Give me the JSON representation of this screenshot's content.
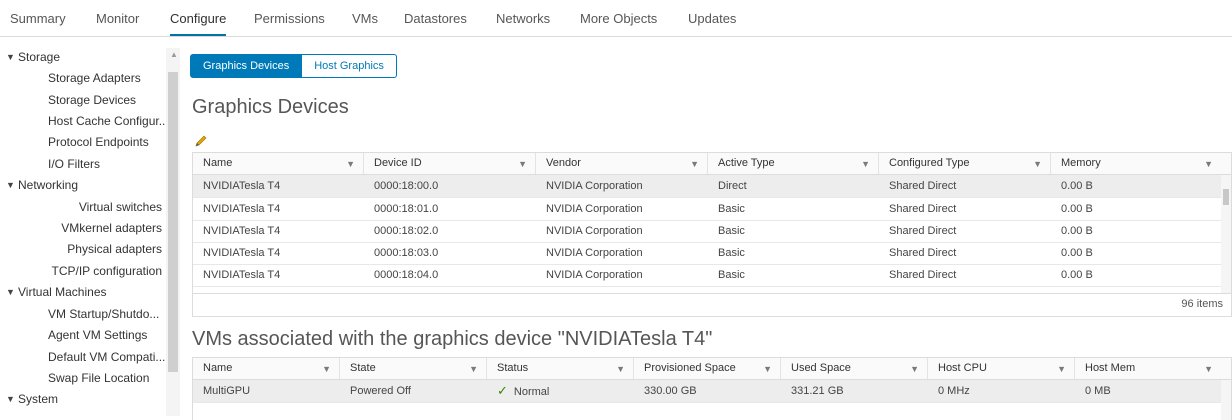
{
  "tabs": [
    "Summary",
    "Monitor",
    "Configure",
    "Permissions",
    "VMs",
    "Datastores",
    "Networks",
    "More Objects",
    "Updates"
  ],
  "active_tab": "Configure",
  "sidebar": {
    "storage": {
      "label": "Storage",
      "items": [
        "Storage Adapters",
        "Storage Devices",
        "Host Cache Configur...",
        "Protocol Endpoints",
        "I/O Filters"
      ]
    },
    "networking": {
      "label": "Networking",
      "items": [
        "Virtual switches",
        "VMkernel adapters",
        "Physical adapters",
        "TCP/IP configuration"
      ]
    },
    "vms": {
      "label": "Virtual Machines",
      "items": [
        "VM Startup/Shutdo...",
        "Agent VM Settings",
        "Default VM Compati...",
        "Swap File Location"
      ]
    },
    "system": {
      "label": "System"
    }
  },
  "toggle": {
    "graphics_devices": "Graphics Devices",
    "host_graphics": "Host Graphics"
  },
  "section_title": "Graphics Devices",
  "devices_grid": {
    "columns": [
      "Name",
      "Device ID",
      "Vendor",
      "Active Type",
      "Configured Type",
      "Memory"
    ],
    "rows": [
      [
        "NVIDIATesla T4",
        "0000:18:00.0",
        "NVIDIA Corporation",
        "Direct",
        "Shared Direct",
        "0.00 B"
      ],
      [
        "NVIDIATesla T4",
        "0000:18:01.0",
        "NVIDIA Corporation",
        "Basic",
        "Shared Direct",
        "0.00 B"
      ],
      [
        "NVIDIATesla T4",
        "0000:18:02.0",
        "NVIDIA Corporation",
        "Basic",
        "Shared Direct",
        "0.00 B"
      ],
      [
        "NVIDIATesla T4",
        "0000:18:03.0",
        "NVIDIA Corporation",
        "Basic",
        "Shared Direct",
        "0.00 B"
      ],
      [
        "NVIDIATesla T4",
        "0000:18:04.0",
        "NVIDIA Corporation",
        "Basic",
        "Shared Direct",
        "0.00 B"
      ]
    ],
    "item_count": "96 items"
  },
  "vms_title": "VMs associated with the graphics device \"NVIDIATesla T4\"",
  "vms_grid": {
    "columns": [
      "Name",
      "State",
      "Status",
      "Provisioned Space",
      "Used Space",
      "Host CPU",
      "Host Mem"
    ],
    "rows": [
      {
        "name": "MultiGPU",
        "state": "Powered Off",
        "status": "Normal",
        "provisioned": "330.00 GB",
        "used": "331.21 GB",
        "cpu": "0 MHz",
        "mem": "0 MB"
      }
    ]
  },
  "colors": {
    "accent": "#0079b8",
    "status_ok": "#3c8500"
  }
}
